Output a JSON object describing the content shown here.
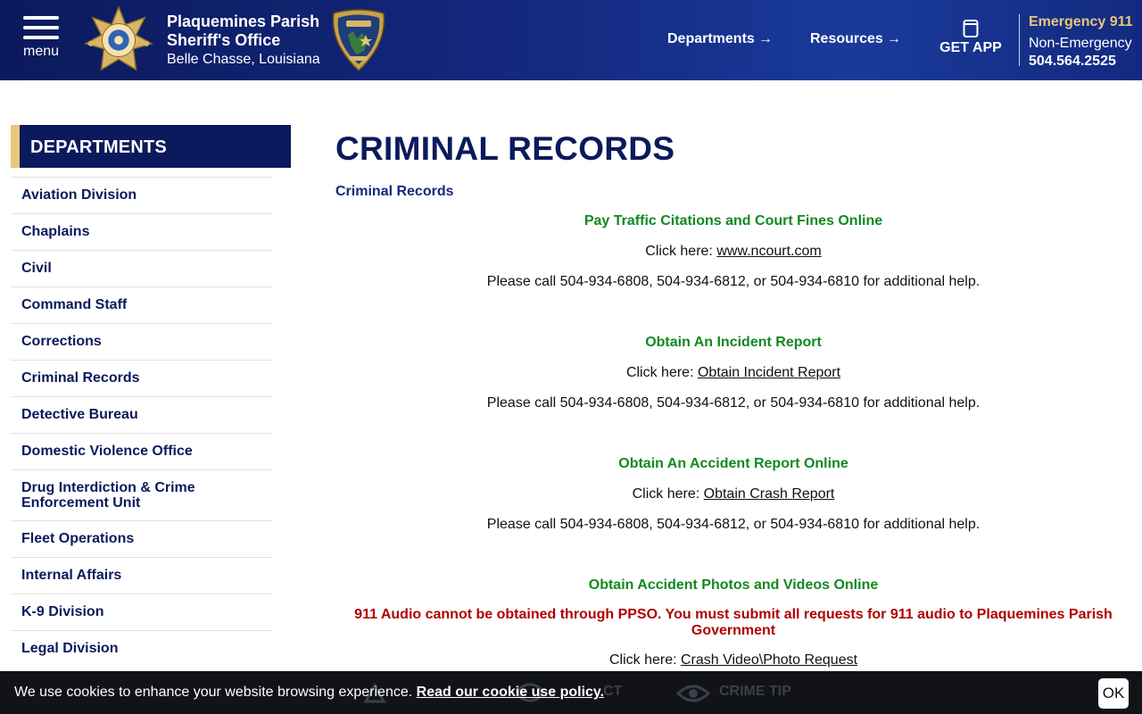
{
  "header": {
    "menu_label": "menu",
    "org_line1": "Plaquemines Parish",
    "org_line2": "Sheriff's Office",
    "location": "Belle Chasse, Louisiana",
    "nav": [
      {
        "label": "Departments"
      },
      {
        "label": "Resources"
      }
    ],
    "get_app": "GET APP",
    "emergency": "Emergency 911",
    "non_emergency_label": "Non-Emergency",
    "non_emergency_phone": "504.564.2525"
  },
  "sidebar": {
    "heading": "DEPARTMENTS",
    "items": [
      {
        "label": "Aviation Division"
      },
      {
        "label": "Chaplains"
      },
      {
        "label": "Civil"
      },
      {
        "label": "Command Staff"
      },
      {
        "label": "Corrections"
      },
      {
        "label": "Criminal Records"
      },
      {
        "label": "Detective Bureau"
      },
      {
        "label": "Domestic Violence Office"
      },
      {
        "label": "Drug Interdiction & Crime Enforcement Unit"
      },
      {
        "label": "Fleet Operations"
      },
      {
        "label": "Internal Affairs"
      },
      {
        "label": "K-9 Division"
      },
      {
        "label": "Legal Division"
      }
    ]
  },
  "main": {
    "title": "CRIMINAL RECORDS",
    "breadcrumb": "Criminal Records",
    "sections": [
      {
        "title": "Pay Traffic Citations and Court Fines Online",
        "click_prefix": "Click here:",
        "link": "www.ncourt.com",
        "help": "Please call 504-934-6808, 504-934-6812, or 504-934-6810 for additional help."
      },
      {
        "title": "Obtain An Incident Report",
        "click_prefix": "Click here:",
        "link": "Obtain Incident Report",
        "help": "Please call 504-934-6808, 504-934-6812, or 504-934-6810 for additional help."
      },
      {
        "title": "Obtain An Accident Report Online",
        "click_prefix": "Click here:",
        "link": "Obtain Crash Report",
        "help": "Please call 504-934-6808, 504-934-6812, or 504-934-6810 for additional help."
      },
      {
        "title": "Obtain Accident Photos and Videos Online",
        "warning": "911 Audio cannot be obtained through PPSO. You must submit all requests for 911 audio to Plaquemines Parish Government",
        "click_prefix": "Click here:",
        "link": "Crash Video\\Photo Request"
      }
    ]
  },
  "footer_bar_ghost": {
    "item2": "CT",
    "item3": "CRIME TIP"
  },
  "cookie": {
    "message": "We use cookies to enhance your website browsing experience.",
    "policy_link": "Read our cookie use policy.",
    "ok": "OK"
  },
  "colors": {
    "navy": "#0b1a5c",
    "gold": "#e8c77b",
    "green": "#0f8a1f",
    "red": "#b00000"
  }
}
